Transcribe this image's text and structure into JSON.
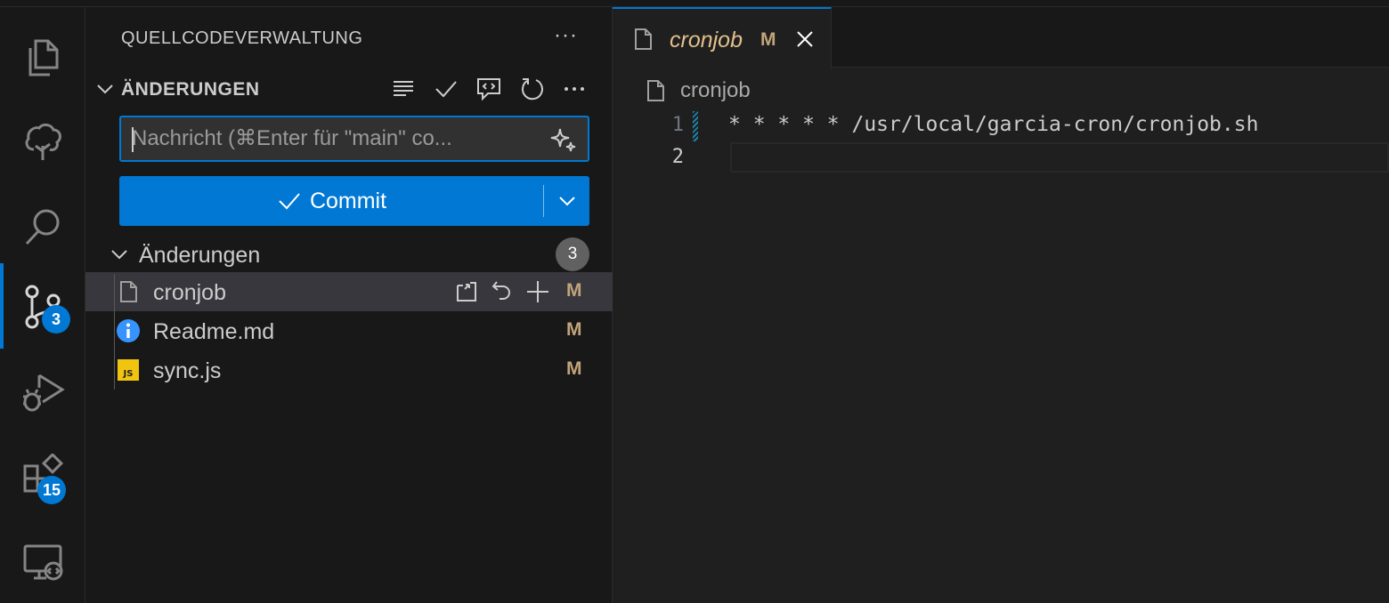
{
  "colors": {
    "accent": "#0078d4",
    "modified": "#c2a47a",
    "tab_modified": "#e2c08d",
    "badge": "#0078d4"
  },
  "activity_bar": {
    "items": [
      {
        "name": "explorer-icon",
        "active": false
      },
      {
        "name": "tree-icon",
        "active": false
      },
      {
        "name": "search-icon",
        "active": false
      },
      {
        "name": "source-control-icon",
        "active": true,
        "badge": "3"
      },
      {
        "name": "run-debug-icon",
        "active": false
      },
      {
        "name": "extensions-icon",
        "active": false,
        "badge": "15"
      },
      {
        "name": "remote-explorer-icon",
        "active": false
      }
    ]
  },
  "sidebar": {
    "title": "QUELLCODEVERWALTUNG",
    "more_label": "···",
    "section": {
      "title": "ÄNDERUNGEN",
      "actions": [
        "list-icon",
        "check-icon",
        "comment-code-icon",
        "refresh-icon",
        "more-icon"
      ]
    },
    "commit_message": {
      "value": "",
      "placeholder": "Nachricht (⌘Enter für \"main\" co..."
    },
    "commit_button": {
      "label": "Commit"
    },
    "changes_group": {
      "label": "Änderungen",
      "count": "3"
    },
    "files": [
      {
        "name": "cronjob",
        "status": "M",
        "icon": "file-icon",
        "selected": true
      },
      {
        "name": "Readme.md",
        "status": "M",
        "icon": "info-icon",
        "selected": false
      },
      {
        "name": "sync.js",
        "status": "M",
        "icon": "js-icon",
        "selected": false
      }
    ]
  },
  "editor": {
    "tab": {
      "name": "cronjob",
      "status": "M"
    },
    "breadcrumb": "cronjob",
    "lines": [
      {
        "number": "1",
        "text": "* * * * * /usr/local/garcia-cron/cronjob.sh"
      },
      {
        "number": "2",
        "text": ""
      }
    ]
  }
}
